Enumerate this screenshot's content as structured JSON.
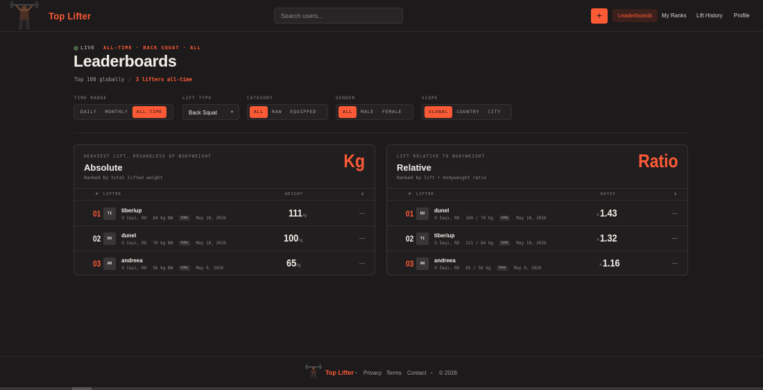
{
  "header": {
    "brand": "Top Lifter",
    "search_placeholder": "Search users...",
    "add_label": "+",
    "nav": [
      {
        "label": "Leaderboards",
        "active": true
      },
      {
        "label": "My Ranks",
        "active": false
      },
      {
        "label": "Lift History",
        "active": false
      },
      {
        "label": "Profile",
        "active": false
      }
    ]
  },
  "hero": {
    "live_label": "LIVE",
    "crumbs": "ALL-TIME · BACK SQUAT · ALL",
    "title": "Leaderboards",
    "subtitle_left": "Top 100 globally",
    "subtitle_sep": "/",
    "subtitle_right": "3 lifters all-time"
  },
  "filters": {
    "time_range": {
      "label": "TIME RANGE",
      "options": [
        "DAILY",
        "MONTHLY",
        "ALL-TIME"
      ],
      "selected": "ALL-TIME"
    },
    "lift_type": {
      "label": "LIFT TYPE",
      "value": "Back Squat"
    },
    "category": {
      "label": "CATEGORY",
      "options": [
        "ALL",
        "RAW",
        "EQUIPPED"
      ],
      "selected": "ALL"
    },
    "gender": {
      "label": "GENDER",
      "options": [
        "ALL",
        "MALE",
        "FEMALE"
      ],
      "selected": "ALL"
    },
    "scope": {
      "label": "SCOPE",
      "options": [
        "GLOBAL",
        "COUNTRY",
        "CITY"
      ],
      "selected": "GLOBAL"
    }
  },
  "absolute": {
    "kicker": "HEAVIEST LIFT, REGARDLESS OF BODYWEIGHT",
    "title": "Absolute",
    "desc": "Ranked by total lifted weight",
    "big": "Kg",
    "col_rank": "#",
    "col_lifter": "LIFTER",
    "col_value": "WEIGHT",
    "col_delta": "Δ",
    "rows": [
      {
        "rank": "01",
        "initials": "TI",
        "name": "tiberiup",
        "location": "Iași, RO",
        "bw": "84 kg BW",
        "badge": "RAW",
        "date": "May 18, 2026",
        "value": "111",
        "unit": "kg",
        "delta": "—"
      },
      {
        "rank": "02",
        "initials": "DU",
        "name": "dunel",
        "location": "Iași, RO",
        "bw": "70 kg BW",
        "badge": "RAW",
        "date": "May 18, 2026",
        "value": "100",
        "unit": "kg",
        "delta": "—"
      },
      {
        "rank": "03",
        "initials": "AN",
        "name": "andreea",
        "location": "Iași, RO",
        "bw": "56 kg BW",
        "badge": "RAW",
        "date": "May 9, 2026",
        "value": "65",
        "unit": "kg",
        "delta": "—"
      }
    ]
  },
  "relative": {
    "kicker": "LIFT RELATIVE TO BODYWEIGHT",
    "title": "Relative",
    "desc": "Ranked by lift ÷ bodyweight ratio",
    "big": "Ratio",
    "col_rank": "#",
    "col_lifter": "LIFTER",
    "col_value": "RATIO",
    "col_delta": "Δ",
    "rows": [
      {
        "rank": "01",
        "initials": "DU",
        "name": "dunel",
        "location": "Iași, RO",
        "bw": "100 / 70 kg",
        "badge": "RAW",
        "date": "May 18, 2026",
        "prefix": "×",
        "value": "1.43",
        "delta": "—"
      },
      {
        "rank": "02",
        "initials": "TI",
        "name": "tiberiup",
        "location": "Iași, RO",
        "bw": "111 / 84 kg",
        "badge": "RAW",
        "date": "May 18, 2026",
        "prefix": "×",
        "value": "1.32",
        "delta": "—"
      },
      {
        "rank": "03",
        "initials": "AN",
        "name": "andreea",
        "location": "Iași, RO",
        "bw": "65 / 56 kg",
        "badge": "RAW",
        "date": "May 9, 2026",
        "prefix": "×",
        "value": "1.16",
        "delta": "—"
      }
    ]
  },
  "footer": {
    "brand": "Top Lifter",
    "links": [
      "Privacy",
      "Terms",
      "Contact"
    ],
    "dot": "•",
    "copyright": "© 2026"
  },
  "colors": {
    "accent": "#ff5a36",
    "background": "#1c1a1b",
    "card": "#211e1f"
  }
}
